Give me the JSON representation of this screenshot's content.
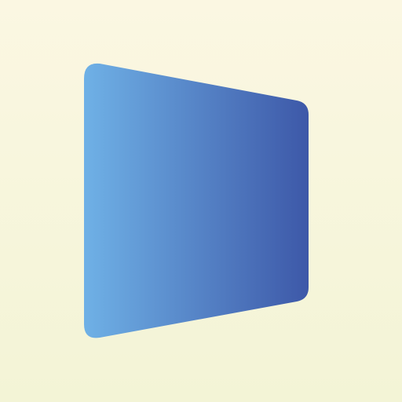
{
  "artwork": {
    "background_colors": [
      "#fbf7e2",
      "#f3f4d6"
    ],
    "shape": {
      "description_name": "perspective-panel",
      "gradient_colors": [
        "#6fb1e6",
        "#3d58a8"
      ]
    }
  }
}
